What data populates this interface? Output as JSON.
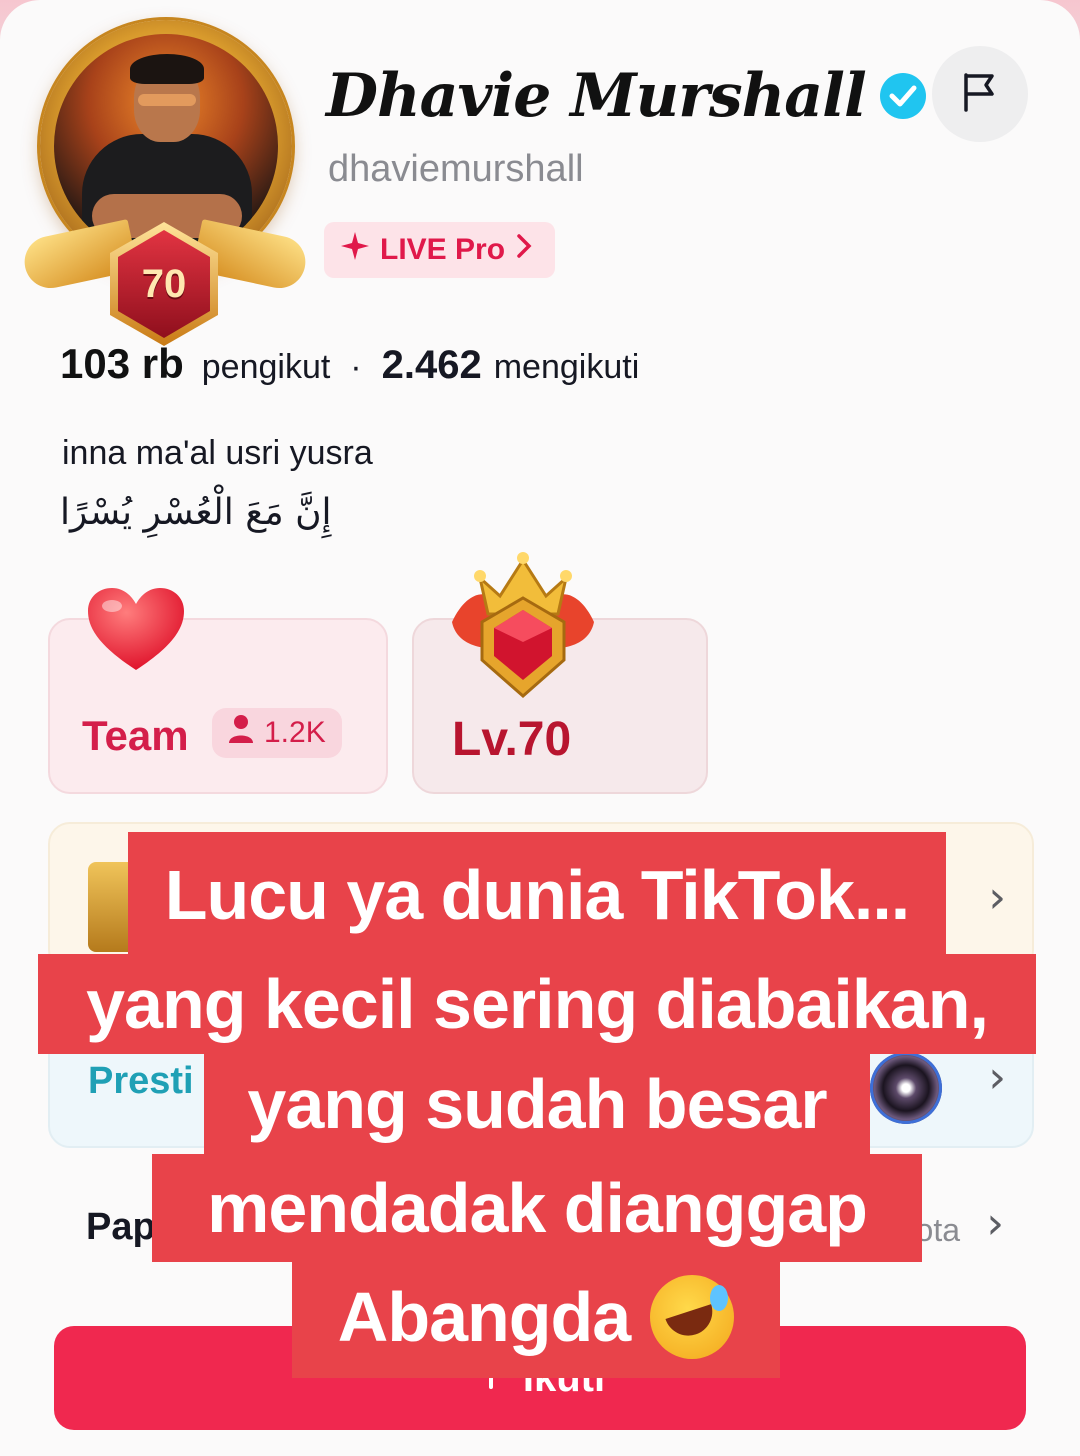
{
  "profile": {
    "display_name": "Dhavie Murshall",
    "username": "dhaviemurshall",
    "avatar_level": "70",
    "live_pro_label": "LIVE Pro"
  },
  "stats": {
    "followers_count": "103 rb",
    "followers_label": "pengikut",
    "separator": "·",
    "following_count": "2.462",
    "following_label": "mengikuti"
  },
  "bio": {
    "line1": "inna ma'al usri yusra",
    "line2": "إِنَّ مَعَ الْعُسْرِ يُسْرًا"
  },
  "badges": {
    "team_label": "Team",
    "team_count": "1.2K",
    "level_label": "Lv.70"
  },
  "rows": {
    "prestige_label": "Presti",
    "pap_label": "Pap",
    "pap_right_text": "ota"
  },
  "follow_button": {
    "label": "Ikuti"
  },
  "caption": {
    "line1": "Lucu ya dunia TikTok...",
    "line2": "yang kecil sering diabaikan,",
    "line3": "yang sudah besar",
    "line4": "mendadak dianggap",
    "line5": "Abangda"
  },
  "icons": {
    "verified": "verified-badge-icon",
    "flag": "flag-icon",
    "sparkle": "sparkle-icon",
    "chevron": "chevron-right-icon",
    "person": "person-icon",
    "heart": "heart-icon",
    "crown": "crown-gem-icon",
    "emoji": "rolling-laughing-emoji"
  },
  "colors": {
    "accent": "#f0284f",
    "caption_bg": "#e8434a",
    "verified": "#20c5f0",
    "team_red": "#d41e4a",
    "prestige_teal": "#1fa0b5"
  }
}
